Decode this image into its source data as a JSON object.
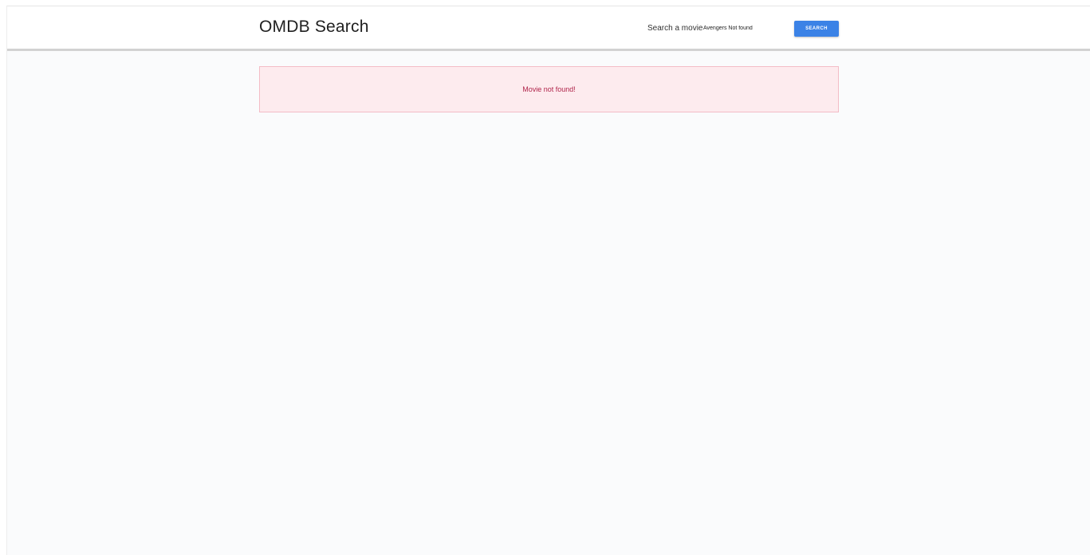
{
  "header": {
    "title": "OMDB Search",
    "search_label": "Search a movie",
    "search_value": "Avengers Not found",
    "search_button_label": "SEARCH"
  },
  "alert": {
    "message": "Movie not found!"
  },
  "colors": {
    "accent": "#3b82e6",
    "alert_bg": "#fdebee",
    "alert_border": "#f3bcc6",
    "alert_text": "#b0244a"
  }
}
